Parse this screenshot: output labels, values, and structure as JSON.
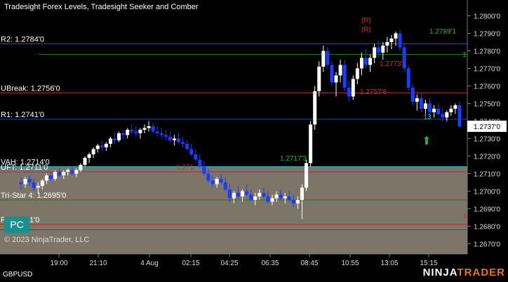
{
  "header": {
    "title": "Tradesight Forex Levels, Tradesight Seeker and Comber"
  },
  "symbol": "GBPUSD",
  "copyright": "© 2023 NinjaTrader, LLC",
  "pc_badge": "PC",
  "brand": {
    "part1": "NINJA",
    "part2": "TRADER"
  },
  "colors": {
    "up_bar": "#ffffff",
    "down_bar": "#1a3cff",
    "background": "#000000",
    "value_area": "#7c7568"
  },
  "chart_data": {
    "type": "candlestick",
    "ylim": [
      1.2667,
      1.2805
    ],
    "y_ticks": [
      "1.2800'0",
      "1.2790'0",
      "1.2780'0",
      "1.2770'0",
      "1.2760'0",
      "1.2750'0",
      "1.2740'0",
      "1.2730'0",
      "1.2720'0",
      "1.2710'0",
      "1.2700'0",
      "1.2690'0",
      "1.2680'0",
      "1.2670'0"
    ],
    "x_ticks": [
      "19:00",
      "21:10",
      "4 Aug",
      "02:15",
      "04:25",
      "06:35",
      "08:45",
      "10:55",
      "13:05",
      "15:15"
    ],
    "current_price": "1.2737'0",
    "levels": [
      {
        "label": "R2: 1.2784'0",
        "value": 1.2784,
        "color": "#2f3fd8"
      },
      {
        "label": "UBreak: 1.2756'0",
        "value": 1.2756,
        "color": "#c42a2a"
      },
      {
        "label": "R1: 1.2741'0",
        "value": 1.2741,
        "color": "#2f3fd8"
      },
      {
        "label": "VAH: 1.2714'0",
        "value": 1.2714,
        "color": "#27b2b2"
      },
      {
        "label": "UFT: 1.2711'0",
        "value": 1.2711,
        "color": "#a02a6a"
      },
      {
        "label": "Tri-Star 4: 1.2695'0",
        "value": 1.2695,
        "color": "#1d7a1d"
      },
      {
        "label": "P: 1.2681'0",
        "value": 1.2681,
        "color": "#c42a2a"
      },
      {
        "label": "",
        "value": 1.2678,
        "color": "#2f3fd8"
      }
    ],
    "annotations": [
      {
        "text": "1.2789'1",
        "value": 1.2789,
        "color": "#2bb32b"
      },
      {
        "text": "1.2773'1",
        "value": 1.2773,
        "color": "#e02020"
      },
      {
        "text": "1.2757'8",
        "value": 1.2757,
        "color": "#e02020"
      },
      {
        "text": "1.2717'3",
        "value": 1.2717,
        "color": "#2bb32b"
      },
      {
        "text": "1.271",
        "value": 1.2714,
        "color": "#e02020"
      },
      {
        "text": "(R)",
        "color": "#e02020"
      },
      {
        "text": "(R)",
        "color": "#e02020"
      },
      {
        "text": "13",
        "color": "#27c8c8"
      },
      {
        "text": "1",
        "color": "#2bb32b"
      },
      {
        "text": "1",
        "color": "#e02020"
      }
    ],
    "bars": [
      [
        1.2705,
        1.2708,
        1.2701,
        1.2704
      ],
      [
        1.2704,
        1.2708,
        1.2702,
        1.2707
      ],
      [
        1.2707,
        1.2709,
        1.2703,
        1.2705
      ],
      [
        1.2705,
        1.2707,
        1.27,
        1.2702
      ],
      [
        1.2702,
        1.2705,
        1.2699,
        1.2703
      ],
      [
        1.2703,
        1.2707,
        1.2701,
        1.2706
      ],
      [
        1.2706,
        1.271,
        1.2704,
        1.2709
      ],
      [
        1.2709,
        1.2711,
        1.2706,
        1.2707
      ],
      [
        1.2707,
        1.2712,
        1.2706,
        1.2711
      ],
      [
        1.2711,
        1.2713,
        1.2708,
        1.2709
      ],
      [
        1.2709,
        1.2712,
        1.2707,
        1.2711
      ],
      [
        1.2711,
        1.2713,
        1.2709,
        1.2712
      ],
      [
        1.2712,
        1.2714,
        1.2709,
        1.271
      ],
      [
        1.271,
        1.2713,
        1.2708,
        1.2712
      ],
      [
        1.2712,
        1.2716,
        1.2711,
        1.2715
      ],
      [
        1.2715,
        1.272,
        1.2714,
        1.2719
      ],
      [
        1.2719,
        1.2722,
        1.2716,
        1.2721
      ],
      [
        1.2721,
        1.2725,
        1.2719,
        1.2724
      ],
      [
        1.2724,
        1.2727,
        1.2722,
        1.2726
      ],
      [
        1.2726,
        1.2729,
        1.2723,
        1.2725
      ],
      [
        1.2725,
        1.2728,
        1.2723,
        1.2727
      ],
      [
        1.2727,
        1.2731,
        1.2725,
        1.273
      ],
      [
        1.273,
        1.2733,
        1.2727,
        1.2729
      ],
      [
        1.2729,
        1.2734,
        1.2728,
        1.2733
      ],
      [
        1.2733,
        1.2735,
        1.273,
        1.2732
      ],
      [
        1.2732,
        1.2736,
        1.273,
        1.2735
      ],
      [
        1.2735,
        1.2738,
        1.2732,
        1.2734
      ],
      [
        1.2734,
        1.2737,
        1.2731,
        1.2733
      ],
      [
        1.2733,
        1.2736,
        1.273,
        1.2735
      ],
      [
        1.2735,
        1.2738,
        1.2733,
        1.2736
      ],
      [
        1.2736,
        1.274,
        1.2734,
        1.2737
      ],
      [
        1.2737,
        1.2739,
        1.2733,
        1.2734
      ],
      [
        1.2734,
        1.2737,
        1.2731,
        1.2733
      ],
      [
        1.2733,
        1.2736,
        1.273,
        1.2732
      ],
      [
        1.2732,
        1.2735,
        1.2729,
        1.2731
      ],
      [
        1.2731,
        1.2734,
        1.2728,
        1.2729
      ],
      [
        1.2729,
        1.2732,
        1.2726,
        1.273
      ],
      [
        1.273,
        1.2733,
        1.2727,
        1.2728
      ],
      [
        1.2728,
        1.2731,
        1.2725,
        1.2727
      ],
      [
        1.2727,
        1.2729,
        1.2723,
        1.2724
      ],
      [
        1.2724,
        1.2727,
        1.272,
        1.2721
      ],
      [
        1.2721,
        1.2724,
        1.2717,
        1.2718
      ],
      [
        1.2718,
        1.2721,
        1.2713,
        1.2714
      ],
      [
        1.2714,
        1.2717,
        1.2709,
        1.271
      ],
      [
        1.271,
        1.2713,
        1.2705,
        1.2706
      ],
      [
        1.2706,
        1.2709,
        1.2702,
        1.2704
      ],
      [
        1.2704,
        1.2708,
        1.2702,
        1.2707
      ],
      [
        1.2707,
        1.271,
        1.2704,
        1.2705
      ],
      [
        1.2705,
        1.2708,
        1.27,
        1.2701
      ],
      [
        1.2701,
        1.2704,
        1.2694,
        1.2696
      ],
      [
        1.2696,
        1.27,
        1.2693,
        1.2699
      ],
      [
        1.2699,
        1.2703,
        1.2696,
        1.2697
      ],
      [
        1.2697,
        1.2701,
        1.2694,
        1.27
      ],
      [
        1.27,
        1.2704,
        1.2697,
        1.2698
      ],
      [
        1.2698,
        1.2701,
        1.2694,
        1.2695
      ],
      [
        1.2695,
        1.2699,
        1.2692,
        1.2697
      ],
      [
        1.2697,
        1.2701,
        1.2695,
        1.2699
      ],
      [
        1.2699,
        1.2702,
        1.2696,
        1.2697
      ],
      [
        1.2697,
        1.27,
        1.2693,
        1.2694
      ],
      [
        1.2694,
        1.2698,
        1.2692,
        1.2696
      ],
      [
        1.2696,
        1.27,
        1.2694,
        1.2698
      ],
      [
        1.2698,
        1.2701,
        1.2695,
        1.2696
      ],
      [
        1.2696,
        1.2699,
        1.2693,
        1.2697
      ],
      [
        1.2697,
        1.27,
        1.2694,
        1.2695
      ],
      [
        1.2695,
        1.2698,
        1.2691,
        1.2693
      ],
      [
        1.2693,
        1.2697,
        1.269,
        1.2695
      ],
      [
        1.2695,
        1.2704,
        1.2684,
        1.2702
      ],
      [
        1.2702,
        1.2718,
        1.27,
        1.2716
      ],
      [
        1.2716,
        1.274,
        1.2714,
        1.2738
      ],
      [
        1.2738,
        1.276,
        1.2735,
        1.2757
      ],
      [
        1.2757,
        1.2774,
        1.2754,
        1.2771
      ],
      [
        1.2771,
        1.2783,
        1.2768,
        1.278
      ],
      [
        1.278,
        1.2782,
        1.277,
        1.2772
      ],
      [
        1.2772,
        1.2774,
        1.276,
        1.2762
      ],
      [
        1.2762,
        1.2768,
        1.2754,
        1.2766
      ],
      [
        1.2766,
        1.2775,
        1.2762,
        1.2772
      ],
      [
        1.2772,
        1.2775,
        1.2757,
        1.2759
      ],
      [
        1.2759,
        1.2763,
        1.2751,
        1.2754
      ],
      [
        1.2754,
        1.2766,
        1.2752,
        1.2764
      ],
      [
        1.2764,
        1.2773,
        1.2761,
        1.277
      ],
      [
        1.277,
        1.2779,
        1.2766,
        1.2776
      ],
      [
        1.2776,
        1.2781,
        1.277,
        1.2772
      ],
      [
        1.2772,
        1.2778,
        1.2768,
        1.2776
      ],
      [
        1.2776,
        1.2784,
        1.2773,
        1.2782
      ],
      [
        1.2782,
        1.2786,
        1.2776,
        1.2779
      ],
      [
        1.2779,
        1.2785,
        1.2775,
        1.2783
      ],
      [
        1.2783,
        1.2788,
        1.2779,
        1.2785
      ],
      [
        1.2785,
        1.2789,
        1.2781,
        1.2787
      ],
      [
        1.2787,
        1.2791,
        1.2783,
        1.279
      ],
      [
        1.279,
        1.2792,
        1.278,
        1.2782
      ],
      [
        1.2782,
        1.2784,
        1.2768,
        1.277
      ],
      [
        1.277,
        1.2772,
        1.2757,
        1.2759
      ],
      [
        1.2759,
        1.2761,
        1.2749,
        1.2751
      ],
      [
        1.2751,
        1.2755,
        1.2746,
        1.2753
      ],
      [
        1.2753,
        1.2756,
        1.2745,
        1.2747
      ],
      [
        1.2747,
        1.2752,
        1.2744,
        1.275
      ],
      [
        1.275,
        1.2753,
        1.2743,
        1.2745
      ],
      [
        1.2745,
        1.2749,
        1.2742,
        1.2747
      ],
      [
        1.2747,
        1.275,
        1.2743,
        1.2744
      ],
      [
        1.2744,
        1.2747,
        1.274,
        1.2742
      ],
      [
        1.2742,
        1.2746,
        1.274,
        1.2745
      ],
      [
        1.2745,
        1.2749,
        1.2743,
        1.2747
      ],
      [
        1.2747,
        1.275,
        1.2744,
        1.2749
      ],
      [
        1.2749,
        1.2751,
        1.2736,
        1.2737
      ]
    ]
  }
}
